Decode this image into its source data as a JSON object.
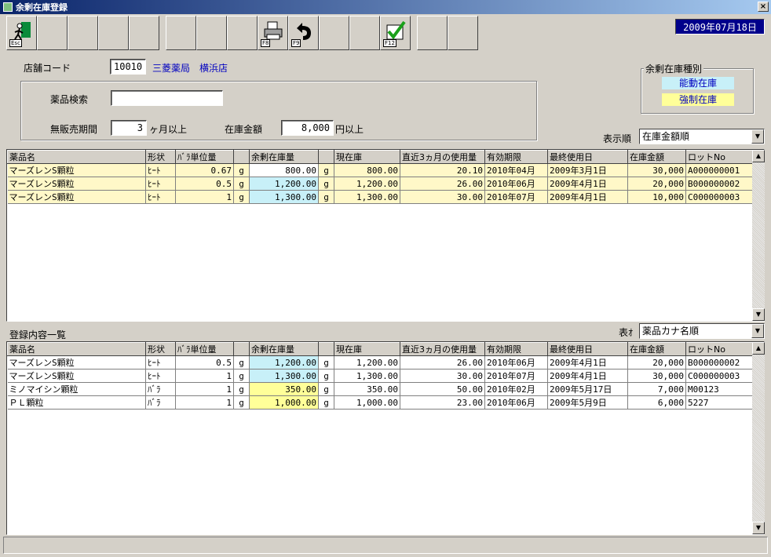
{
  "window": {
    "title": "余剰在庫登録",
    "close_label": "×"
  },
  "toolbar": {
    "exit_key": "Esc",
    "print_key": "F8",
    "back_key": "F9",
    "confirm_key": "F12"
  },
  "date": "2009年07月18日",
  "store": {
    "label": "店舗コード",
    "code": "10010",
    "name": "三菱薬局　横浜店"
  },
  "search": {
    "drug_label": "薬品検索",
    "drug_value": "",
    "period_label": "無販売期間",
    "period_value": "3",
    "period_unit": "ヶ月以上",
    "amount_label": "在庫金額",
    "amount_value": "8,000",
    "amount_unit": "円以上"
  },
  "surplus_type": {
    "title": "余剰在庫種別",
    "active": "能動在庫",
    "forced": "強制在庫",
    "active_color": "#c8f0f8",
    "forced_color": "#ffff99"
  },
  "upper": {
    "sort_label": "表示順",
    "sort_value": "在庫金額順",
    "headers": [
      "薬品名",
      "形状",
      "ﾊﾞﾗ単位量",
      "",
      "余剰在庫量",
      "",
      "現在庫",
      "直近3ヵ月の使用量",
      "有効期限",
      "最終使用日",
      "在庫金額",
      "ロットNo"
    ],
    "rows": [
      [
        "マーズレンS顆粒",
        "ﾋｰﾄ",
        "0.67",
        "g",
        "800.00",
        "g",
        "800.00",
        "20.10",
        "2010年04月",
        "2009年3月1日",
        "30,000",
        "A000000001"
      ],
      [
        "マーズレンS顆粒",
        "ﾋｰﾄ",
        "0.5",
        "g",
        "1,200.00",
        "g",
        "1,200.00",
        "26.00",
        "2010年06月",
        "2009年4月1日",
        "20,000",
        "B000000002"
      ],
      [
        "マーズレンS顆粒",
        "ﾋｰﾄ",
        "1",
        "g",
        "1,300.00",
        "g",
        "1,300.00",
        "30.00",
        "2010年07月",
        "2009年4月1日",
        "10,000",
        "C000000003"
      ]
    ]
  },
  "lower": {
    "section_title": "登録内容一覧",
    "sort_label": "表ｵ",
    "sort_value": "薬品カナ名順",
    "headers": [
      "薬品名",
      "形状",
      "ﾊﾞﾗ単位量",
      "",
      "余剰在庫量",
      "",
      "現在庫",
      "直近3ヵ月の使用量",
      "有効期限",
      "最終使用日",
      "在庫金額",
      "ロットNo"
    ],
    "rows": [
      [
        "マーズレンS顆粒",
        "ﾋｰﾄ",
        "0.5",
        "g",
        "1,200.00",
        "g",
        "1,200.00",
        "26.00",
        "2010年06月",
        "2009年4月1日",
        "20,000",
        "B000000002"
      ],
      [
        "マーズレンS顆粒",
        "ﾋｰﾄ",
        "1",
        "g",
        "1,300.00",
        "g",
        "1,300.00",
        "30.00",
        "2010年07月",
        "2009年4月1日",
        "30,000",
        "C000000003"
      ],
      [
        "ミノマイシン顆粒",
        "ﾊﾞﾗ",
        "1",
        "g",
        "350.00",
        "g",
        "350.00",
        "50.00",
        "2010年02月",
        "2009年5月17日",
        "7,000",
        "M00123"
      ],
      [
        "ＰＬ顆粒",
        "ﾊﾞﾗ",
        "1",
        "g",
        "1,000.00",
        "g",
        "1,000.00",
        "23.00",
        "2010年06月",
        "2009年5月9日",
        "6,000",
        "5227"
      ]
    ]
  }
}
